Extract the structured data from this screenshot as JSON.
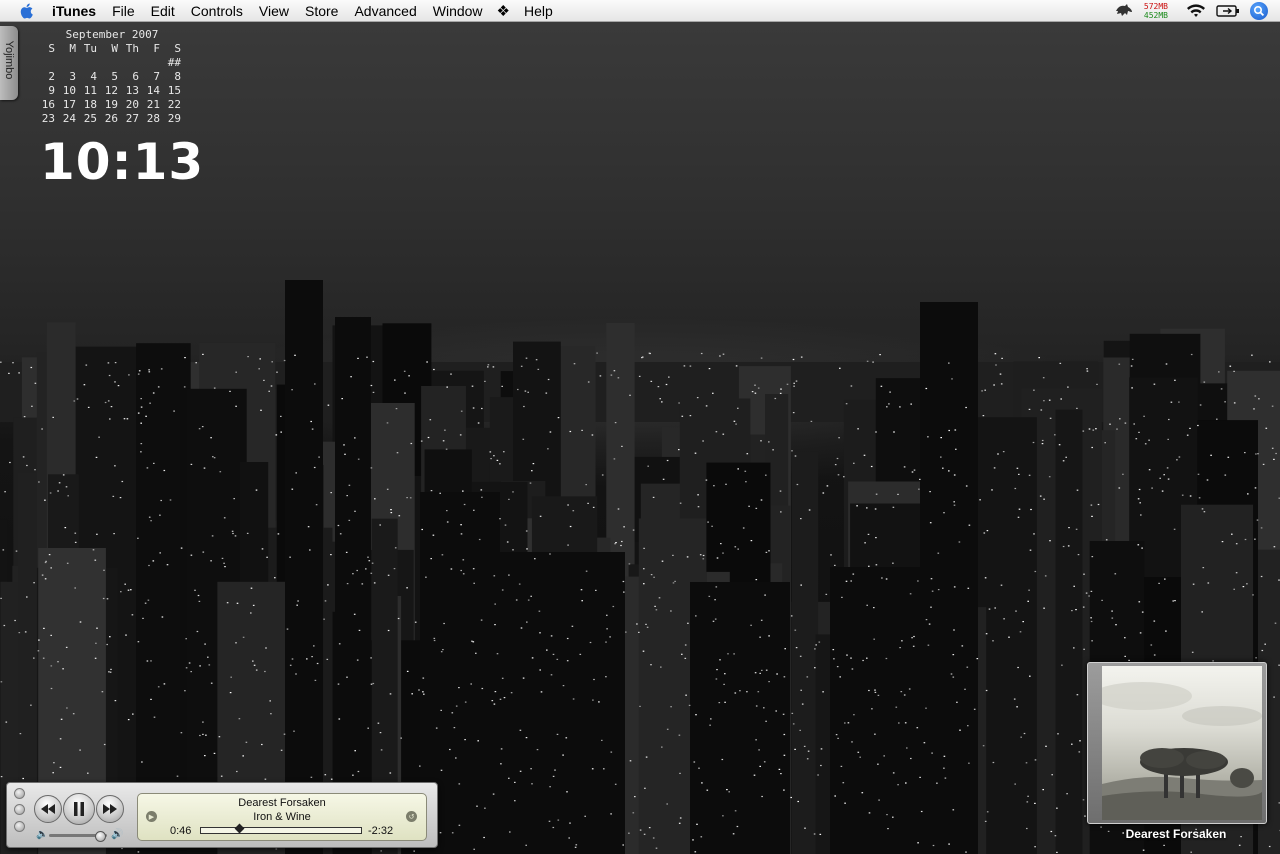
{
  "menubar": {
    "apple_icon": "apple-icon",
    "items": [
      "iTunes",
      "File",
      "Edit",
      "Controls",
      "View",
      "Store",
      "Advanced",
      "Window",
      "Help"
    ],
    "script_icon": "script-menu-icon",
    "memory": {
      "used": "572MB",
      "free": "452MB"
    },
    "status_icons": [
      "growl-icon",
      "wifi-icon",
      "battery-icon",
      "spotlight-icon"
    ]
  },
  "yojimbo": {
    "label": "Yojimbo"
  },
  "calendar": {
    "title": "September 2007",
    "weekdays": [
      "S",
      "M",
      "Tu",
      "W",
      "Th",
      "F",
      "S"
    ],
    "weeks": [
      [
        "",
        "",
        "",
        "",
        "",
        "",
        "##"
      ],
      [
        "2",
        "3",
        "4",
        "5",
        "6",
        "7",
        "8"
      ],
      [
        "9",
        "10",
        "11",
        "12",
        "13",
        "14",
        "15"
      ],
      [
        "16",
        "17",
        "18",
        "19",
        "20",
        "21",
        "22"
      ],
      [
        "23",
        "24",
        "25",
        "26",
        "27",
        "28",
        "29"
      ]
    ]
  },
  "clock": {
    "time": "10:13"
  },
  "miniplayer": {
    "track_title": "Dearest Forsaken",
    "artist": "Iron & Wine",
    "elapsed": "0:46",
    "remaining": "-2:32",
    "progress": 0.23,
    "volume": 0.88
  },
  "album": {
    "caption": "Dearest Forsaken"
  },
  "colors": {
    "wallpaper": "#1b1b1b",
    "menubar": "#eeeeee",
    "lcd": "#e9ebd0"
  }
}
